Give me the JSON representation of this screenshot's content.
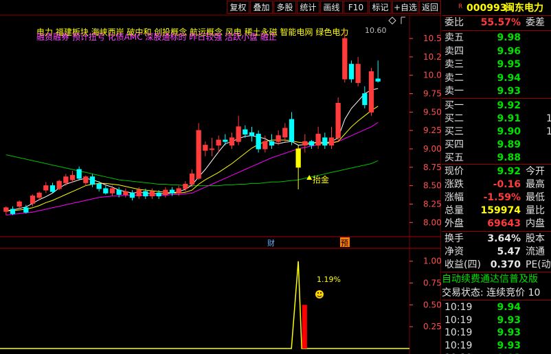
{
  "toolbar": {
    "buttons": [
      "复权",
      "叠加",
      "多股",
      "统计",
      "画线",
      "F10",
      "标记",
      "+自选",
      "返回"
    ]
  },
  "stock_header": {
    "badge": "R",
    "code": "000993",
    "name": "闽东电力"
  },
  "chart_header": {
    "line1": "电力    福建板块  海峡西岸 破中和 创投概念 航运概念 风电 稀土永磁 智能电网 绿色电力",
    "line2": "融资融券 预计扭亏 化债AMC 深股通标的 昨日较强 活跃小盘 融正",
    "high_mark": "10.60",
    "diamond_icon": "diamond-icon"
  },
  "markers": {
    "cai": "财",
    "yu": "预",
    "signal": "抬金",
    "pct": "1.19%"
  },
  "chart_data": {
    "type": "candlestick",
    "main_ylim": [
      7.9,
      10.65
    ],
    "main_ticks": [
      "10.50",
      "10.25",
      "10.00",
      "9.75",
      "9.50",
      "9.25",
      "9.00",
      "8.75",
      "8.50",
      "8.25",
      "8.00"
    ],
    "sub_ylim": [
      0,
      1.1
    ],
    "sub_ticks": [
      "1.00",
      "0.75",
      "0.50",
      "0.25"
    ],
    "candles": [
      [
        8.15,
        8.2,
        8.1,
        8.22
      ],
      [
        8.18,
        8.12,
        8.1,
        8.22
      ],
      [
        8.22,
        8.28,
        8.18,
        8.3
      ],
      [
        8.2,
        8.14,
        8.12,
        8.24
      ],
      [
        8.26,
        8.36,
        8.22,
        8.38
      ],
      [
        8.34,
        8.4,
        8.3,
        8.42
      ],
      [
        8.44,
        8.5,
        8.4,
        8.55
      ],
      [
        8.5,
        8.42,
        8.4,
        8.54
      ],
      [
        8.46,
        8.56,
        8.44,
        8.58
      ],
      [
        8.54,
        8.62,
        8.5,
        8.66
      ],
      [
        8.58,
        8.64,
        8.54,
        8.7
      ],
      [
        8.72,
        8.6,
        8.58,
        8.76
      ],
      [
        8.54,
        8.62,
        8.5,
        8.64
      ],
      [
        8.62,
        8.52,
        8.48,
        8.66
      ],
      [
        8.52,
        8.46,
        8.42,
        8.56
      ],
      [
        8.46,
        8.4,
        8.38,
        8.5
      ],
      [
        8.4,
        8.46,
        8.36,
        8.5
      ],
      [
        8.44,
        8.38,
        8.34,
        8.48
      ],
      [
        8.38,
        8.42,
        8.34,
        8.46
      ],
      [
        8.4,
        8.34,
        8.3,
        8.44
      ],
      [
        8.36,
        8.44,
        8.32,
        8.48
      ],
      [
        8.42,
        8.36,
        8.32,
        8.46
      ],
      [
        8.36,
        8.42,
        8.32,
        8.46
      ],
      [
        8.4,
        8.36,
        8.32,
        8.44
      ],
      [
        8.38,
        8.44,
        8.34,
        8.48
      ],
      [
        8.44,
        8.4,
        8.36,
        8.48
      ],
      [
        8.4,
        8.46,
        8.36,
        8.5
      ],
      [
        8.46,
        8.52,
        8.42,
        8.56
      ],
      [
        8.52,
        8.66,
        8.48,
        8.72
      ],
      [
        8.6,
        9.25,
        8.58,
        9.35
      ],
      [
        8.98,
        9.05,
        8.9,
        9.1
      ],
      [
        9.0,
        9.0,
        8.9,
        9.15
      ],
      [
        9.05,
        9.12,
        8.95,
        9.18
      ],
      [
        9.12,
        9.1,
        9.05,
        9.2
      ],
      [
        9.05,
        9.15,
        9.0,
        9.22
      ],
      [
        9.1,
        9.3,
        9.05,
        9.45
      ],
      [
        9.26,
        9.2,
        9.15,
        9.32
      ],
      [
        9.22,
        9.18,
        9.1,
        9.3
      ],
      [
        9.2,
        9.0,
        8.95,
        9.25
      ],
      [
        9.0,
        9.1,
        8.95,
        9.18
      ],
      [
        9.1,
        9.05,
        9.0,
        9.2
      ],
      [
        9.1,
        9.18,
        9.05,
        9.25
      ],
      [
        9.16,
        9.28,
        9.1,
        9.35
      ],
      [
        9.4,
        9.1,
        9.05,
        9.5
      ],
      [
        8.75,
        9.0,
        8.45,
        9.05
      ],
      [
        9.05,
        9.1,
        8.95,
        9.2
      ],
      [
        9.1,
        9.05,
        9.0,
        9.12
      ],
      [
        9.05,
        9.2,
        9.0,
        9.3
      ],
      [
        9.15,
        9.05,
        9.0,
        9.22
      ],
      [
        9.05,
        9.15,
        9.0,
        9.3
      ],
      [
        9.15,
        9.62,
        9.1,
        9.7
      ],
      [
        9.95,
        10.5,
        9.9,
        10.6
      ],
      [
        10.15,
        9.95,
        9.9,
        10.2
      ],
      [
        9.9,
        10.15,
        9.85,
        10.25
      ],
      [
        9.75,
        9.6,
        9.55,
        9.85
      ],
      [
        9.5,
        10.05,
        9.45,
        10.1
      ],
      [
        9.95,
        9.92,
        9.9,
        10.2
      ]
    ],
    "ma5": [
      8.16,
      8.17,
      8.19,
      8.21,
      8.26,
      8.31,
      8.35,
      8.4,
      8.47,
      8.52,
      8.55,
      8.58,
      8.6,
      8.58,
      8.55,
      8.51,
      8.48,
      8.44,
      8.42,
      8.4,
      8.41,
      8.4,
      8.39,
      8.39,
      8.39,
      8.4,
      8.42,
      8.45,
      8.51,
      8.62,
      8.72,
      8.84,
      8.96,
      9.07,
      9.1,
      9.14,
      9.17,
      9.18,
      9.16,
      9.14,
      9.09,
      9.07,
      9.09,
      9.1,
      9.05,
      9.06,
      9.07,
      9.1,
      9.08,
      9.1,
      9.15,
      9.4,
      9.55,
      9.65,
      9.75,
      9.8,
      9.82
    ],
    "ma10": [
      8.16,
      8.16,
      8.17,
      8.18,
      8.2,
      8.23,
      8.27,
      8.3,
      8.34,
      8.38,
      8.42,
      8.46,
      8.5,
      8.52,
      8.53,
      8.53,
      8.52,
      8.51,
      8.49,
      8.47,
      8.45,
      8.44,
      8.43,
      8.42,
      8.41,
      8.4,
      8.4,
      8.41,
      8.44,
      8.52,
      8.58,
      8.63,
      8.68,
      8.74,
      8.8,
      8.87,
      8.94,
      9.01,
      9.06,
      9.1,
      9.12,
      9.12,
      9.12,
      9.11,
      9.09,
      9.08,
      9.08,
      9.08,
      9.07,
      9.08,
      9.1,
      9.2,
      9.3,
      9.38,
      9.45,
      9.52,
      9.58
    ],
    "ma20": [
      8.1,
      8.11,
      8.12,
      8.13,
      8.14,
      8.16,
      8.18,
      8.2,
      8.22,
      8.24,
      8.26,
      8.28,
      8.3,
      8.32,
      8.34,
      8.35,
      8.36,
      8.36,
      8.37,
      8.37,
      8.37,
      8.37,
      8.37,
      8.37,
      8.37,
      8.38,
      8.38,
      8.39,
      8.4,
      8.44,
      8.48,
      8.52,
      8.56,
      8.6,
      8.64,
      8.68,
      8.72,
      8.76,
      8.8,
      8.84,
      8.88,
      8.91,
      8.94,
      8.97,
      9.0,
      9.02,
      9.04,
      9.06,
      9.08,
      9.09,
      9.1,
      9.14,
      9.18,
      9.22,
      9.26,
      9.3,
      9.36
    ],
    "ma60": [
      8.92,
      8.9,
      8.88,
      8.86,
      8.84,
      8.82,
      8.8,
      8.78,
      8.76,
      8.74,
      8.72,
      8.7,
      8.68,
      8.66,
      8.64,
      8.62,
      8.6,
      8.58,
      8.57,
      8.56,
      8.55,
      8.54,
      8.53,
      8.52,
      8.52,
      8.51,
      8.51,
      8.5,
      8.5,
      8.5,
      8.5,
      8.5,
      8.5,
      8.51,
      8.51,
      8.52,
      8.52,
      8.53,
      8.53,
      8.54,
      8.55,
      8.55,
      8.56,
      8.57,
      8.58,
      8.6,
      8.62,
      8.64,
      8.66,
      8.68,
      8.7,
      8.72,
      8.74,
      8.76,
      8.78,
      8.8,
      8.84
    ],
    "sub_signal": {
      "peak_index": 44,
      "peak_value": 1.0,
      "bar_index": 45,
      "bar_value": 0.5
    }
  },
  "panel": {
    "weibi": {
      "label": "委比",
      "value": "55.57%",
      "label2": "委差"
    },
    "asks": [
      {
        "label": "卖五",
        "price": "9.98"
      },
      {
        "label": "卖四",
        "price": "9.96"
      },
      {
        "label": "卖三",
        "price": "9.95"
      },
      {
        "label": "卖二",
        "price": "9.94"
      },
      {
        "label": "卖一",
        "price": "9.93"
      }
    ],
    "bids": [
      {
        "label": "买一",
        "price": "9.92"
      },
      {
        "label": "买二",
        "price": "9.91"
      },
      {
        "label": "买三",
        "price": "9.90"
      },
      {
        "label": "买四",
        "price": "9.89"
      },
      {
        "label": "买五",
        "price": "9.88"
      }
    ],
    "bid_extras": [
      "1",
      "1"
    ],
    "stats": [
      {
        "label": "现价",
        "value": "9.92",
        "label2": "今开"
      },
      {
        "label": "涨跌",
        "value": "-0.16",
        "label2": "最高"
      },
      {
        "label": "涨幅",
        "value": "-1.59%",
        "label2": "最低"
      },
      {
        "label": "总量",
        "value": "159974",
        "label2": "量比"
      },
      {
        "label": "外盘",
        "value": "69643",
        "label2": "内盘"
      }
    ],
    "stats2": [
      {
        "label": "换手",
        "value": "3.64%",
        "label2": "股本"
      },
      {
        "label": "净资",
        "value": "5.47",
        "label2": "流通"
      },
      {
        "label": "收益(四)",
        "value": "0.370",
        "label2": "PE(动"
      }
    ],
    "notice1": "自动续费通达信普及版",
    "notice2": "交易状态: 连续竞价 10",
    "ticks": [
      {
        "time": "10:19",
        "price": "9.94"
      },
      {
        "time": "10:19",
        "price": "9.93"
      },
      {
        "time": "10:19",
        "price": "9.93"
      },
      {
        "time": "10:19",
        "price": "9.93"
      },
      {
        "time": "10:19",
        "price": "9.93"
      }
    ]
  },
  "colors": {
    "up": "#ff3b3b",
    "down": "#00ffff",
    "ma5": "#ffffff",
    "ma10": "#ffff00",
    "ma20": "#ff00ff",
    "ma60": "#00c000",
    "grid": "#7a0000"
  }
}
